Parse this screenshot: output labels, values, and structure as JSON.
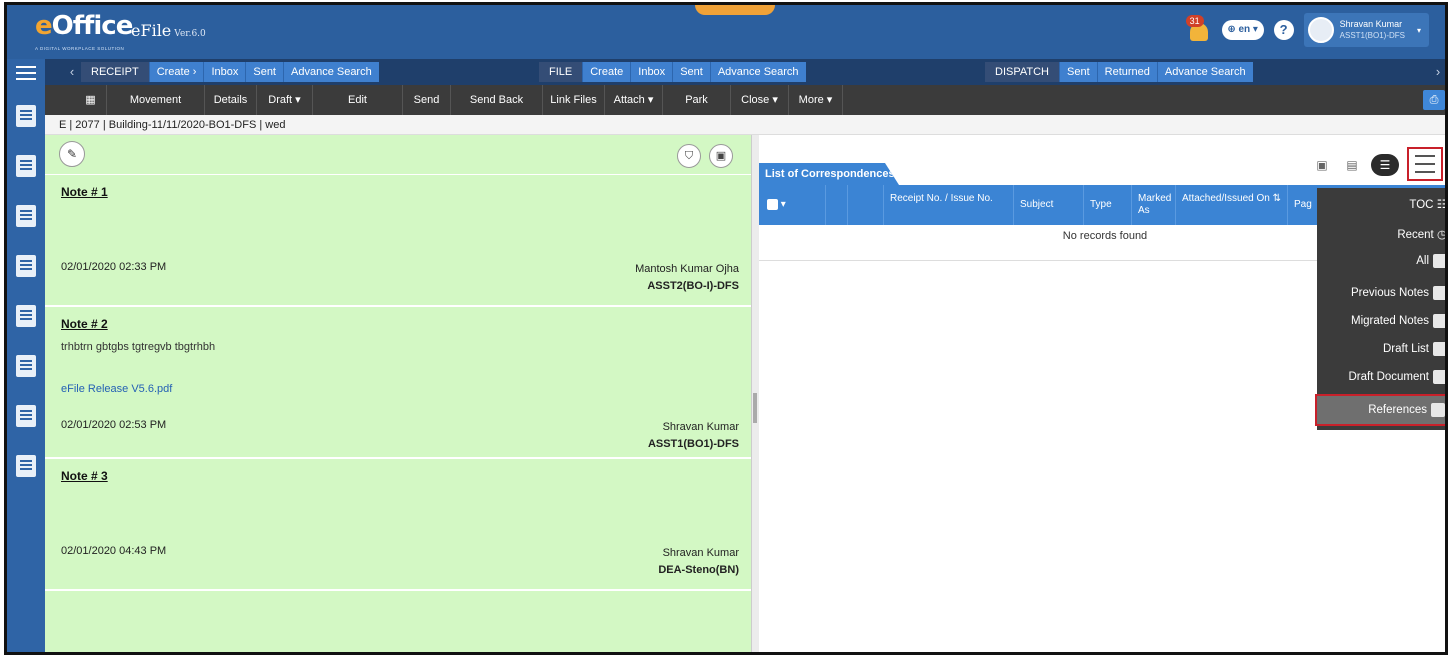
{
  "app": {
    "brand_e": "e",
    "brand_rest": "Office",
    "tagline": "A DIGITAL WORKPLACE SOLUTION",
    "title": "eFile",
    "version": "Ver.6.0",
    "notification_count": "31",
    "language": "en",
    "help": "?",
    "user_name": "Shravan Kumar",
    "user_role": "ASST1(BO1)-DFS"
  },
  "modules": {
    "receipt": {
      "label": "RECEIPT",
      "items": [
        "Create ›",
        "Inbox",
        "Sent",
        "Advance Search"
      ]
    },
    "file": {
      "label": "FILE",
      "items": [
        "Create",
        "Inbox",
        "Sent",
        "Advance Search"
      ]
    },
    "dispatch": {
      "label": "DISPATCH",
      "items": [
        "Sent",
        "Returned",
        "Advance Search"
      ]
    }
  },
  "toolbar": [
    "Movement",
    "Details",
    "Draft ▾",
    "Edit",
    "Send",
    "Send Back",
    "Link Files",
    "Attach ▾",
    "Park",
    "Close ▾",
    "More ▾"
  ],
  "breadcrumb": "E | 2077 | Building-11/11/2020-BO1-DFS | wed",
  "notes": [
    {
      "title": "Note # 1",
      "body": "",
      "link": "",
      "date": "02/01/2020 02:33 PM",
      "name": "Mantosh Kumar Ojha",
      "role": "ASST2(BO-I)-DFS"
    },
    {
      "title": "Note # 2",
      "body": "trhbtrn  gbtgbs  tgtregvb  tbgtrhbh",
      "link": "eFile Release V5.6.pdf",
      "date": "02/01/2020 02:53 PM",
      "name": "Shravan Kumar",
      "role": "ASST1(BO1)-DFS"
    },
    {
      "title": "Note # 3",
      "body": "",
      "link": "",
      "date": "02/01/2020 04:43 PM",
      "name": "Shravan Kumar",
      "role": "DEA-Steno(BN)"
    }
  ],
  "correspondence": {
    "tab_label": "List of Correspondences",
    "columns": [
      "Receipt No. / Issue No.",
      "Subject",
      "Type",
      "Marked As",
      "Attached/Issued On ⇅",
      "Pag"
    ],
    "empty_text": "No records found"
  },
  "menu": {
    "items": [
      "TOC",
      "Recent",
      "All",
      "Previous Notes",
      "Migrated Notes",
      "Draft List",
      "Draft Document",
      "References"
    ],
    "selected": "References"
  }
}
